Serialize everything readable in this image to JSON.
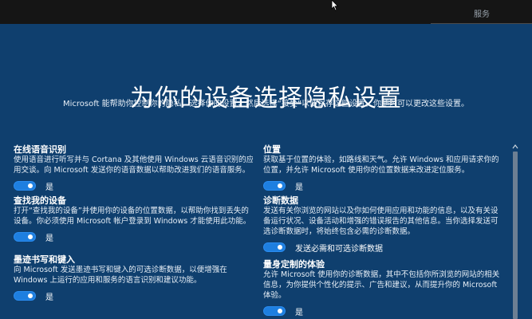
{
  "topbar": {
    "service_tab": "服务"
  },
  "page": {
    "title": "为你的设备选择隐私设置",
    "subtitle": "Microsoft 能帮助你控制你的隐私。选择你的设置，然后选择“接受”以便保存这些设置。你随时可以更改这些设置。"
  },
  "settings_left": [
    {
      "name": "在线语音识别",
      "desc": [
        "使用语音进行听写并与 Cortana 及其他使用 Windows 云语音识别的应",
        "用交谈。向 Microsoft 发送你的语音数据以帮助改进我们的语音服务。"
      ],
      "toggle_label": "是"
    },
    {
      "name": "查找我的设备",
      "desc": [
        "打开“查找我的设备”并使用你的设备的位置数据，以帮助你找到丢失的",
        "设备。你必须使用 Microsoft 帐户登录到 Windows 才能使用此功能。"
      ],
      "toggle_label": "是"
    },
    {
      "name": "墨迹书写和键入",
      "desc": [
        "向 Microsoft 发送墨迹书写和键入的可选诊断数据，以便增强在",
        "Windows 上运行的应用和服务的语言识别和建议功能。"
      ],
      "toggle_label": "是"
    }
  ],
  "settings_right": [
    {
      "name": "位置",
      "desc": [
        "获取基于位置的体验，如路线和天气。允许 Windows 和应用请求你的",
        "位置，并允许 Microsoft 使用你的位置数据来改进定位服务。"
      ],
      "toggle_label": "是"
    },
    {
      "name": "诊断数据",
      "desc": [
        "发送有关你浏览的网站以及你如何使用应用和功能的信息，以及有关设",
        "备运行状况、设备活动和增强的错误报告的其他信息。当你选择发送可",
        "选诊断数据时，将始终包含必需的诊断数据。"
      ],
      "toggle_label": "发送必需和可选诊断数据"
    },
    {
      "name": "量身定制的体验",
      "desc": [
        "允许 Microsoft 使用你的诊断数据，其中不包括你所浏览的网站的相关",
        "信息，为你提供个性化的提示、广告和建议，从而提升你的 Microsoft",
        "体验。"
      ],
      "toggle_label": "是"
    }
  ],
  "colors": {
    "background": "#0f3f6e",
    "toggle_on": "#1e7fe0",
    "topbar": "#151515"
  },
  "icons": {
    "cursor": "mouse-pointer-icon",
    "scroll_up": "chevron-up-icon"
  }
}
